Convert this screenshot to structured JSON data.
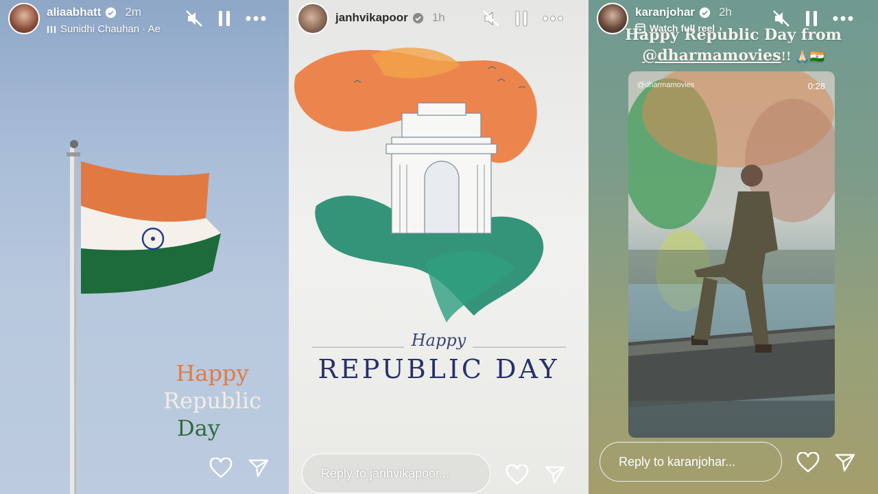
{
  "stories": [
    {
      "username": "aliaabhatt",
      "time": "2m",
      "music": "Sunidhi Chauhan · Ae",
      "greeting": {
        "line1": "Happy",
        "line2": "Republic",
        "line3": "Day"
      },
      "colors": {
        "saffron": "#e07a42",
        "white": "#f5f1ea",
        "green": "#1d6a3b",
        "chakra": "#1f3b8a"
      }
    },
    {
      "username": "janhvikapoor",
      "time": "1h",
      "greeting": {
        "script": "Happy",
        "main": "REPUBLIC DAY"
      },
      "reply_placeholder": "Reply to janhvikapoor..."
    },
    {
      "username": "karanjohar",
      "time": "2h",
      "watch_label": "Watch full reel",
      "caption_line1": "Happy Republic Day from",
      "caption_mention": "@dharmamovies",
      "caption_suffix": "!! 🙏🏻🇮🇳",
      "reel_handle": "@dharmamovies",
      "reel_duration": "0:28",
      "reply_placeholder": "Reply to karanjohar..."
    }
  ],
  "icons": {
    "mute": "muted-speaker-icon",
    "pause": "pause-icon",
    "more": "more-icon",
    "like": "heart-icon",
    "share": "send-icon",
    "verified": "verified-badge-icon"
  }
}
